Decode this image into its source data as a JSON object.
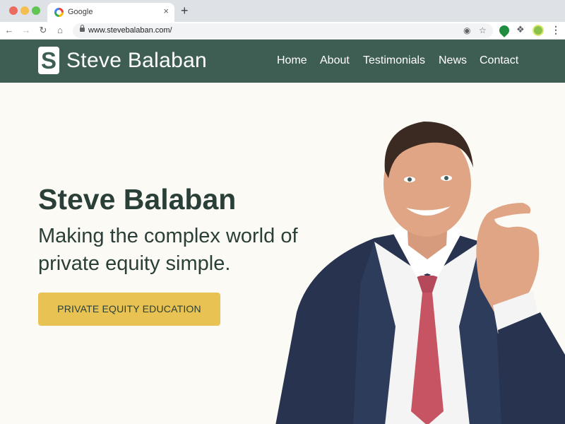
{
  "browser": {
    "tab_title": "Google",
    "tab_close": "×",
    "new_tab": "+",
    "url": "www.stevebalaban.com/",
    "icons": [
      "back-icon",
      "forward-icon",
      "reload-icon",
      "home-icon",
      "lock-icon",
      "extension-icon",
      "star-icon",
      "puzzle-icon",
      "menu-icon"
    ]
  },
  "site": {
    "logo_letter": "S",
    "brand_name": "Steve Balaban",
    "nav": [
      "Home",
      "About",
      "Testimonials",
      "News",
      "Contact"
    ],
    "header_color": "#3f5e53"
  },
  "hero": {
    "name": "Steve Balaban",
    "tagline": "Making the complex world of private equity simple.",
    "cta_label": "PRIVATE EQUITY EDUCATION",
    "cta_color": "#e8c354"
  }
}
